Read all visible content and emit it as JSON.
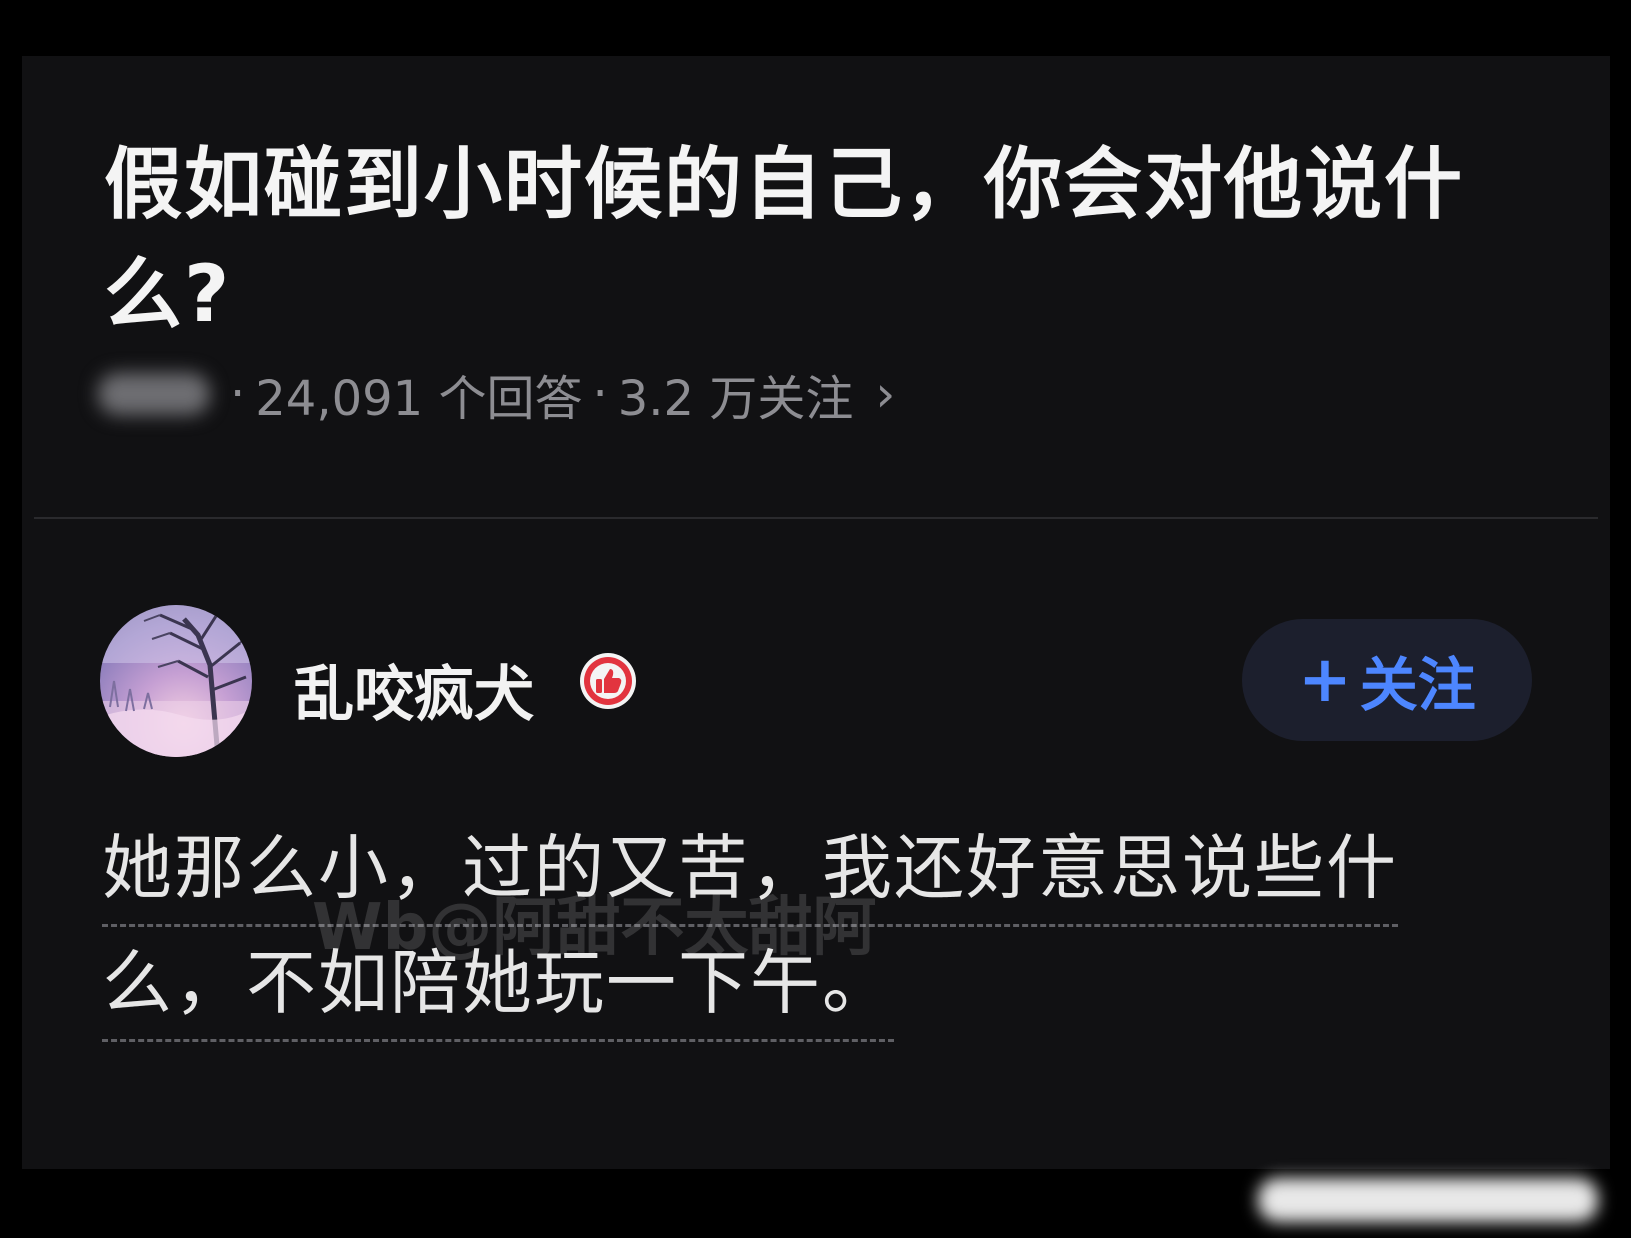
{
  "question": {
    "title": "假如碰到小时候的自己，你会对他说什么?",
    "answers_count": "24,091 个回答",
    "followers": "3.2 万关注",
    "separator": "·",
    "chevron": "›"
  },
  "author": {
    "name": "乱咬疯犬",
    "avatar": "winter-tree-avatar",
    "badge": "thumbs-up-icon",
    "follow_plus": "+",
    "follow_label": "关注"
  },
  "answer": {
    "line1": "她那么小，过的又苦，我还好意思说些什",
    "line2": "么，不如陪她玩一下午。"
  },
  "watermark": "Wb@阿甜不太甜阿",
  "colors": {
    "background": "#111113",
    "accent": "#4d86ff",
    "badge": "#e2343f"
  }
}
